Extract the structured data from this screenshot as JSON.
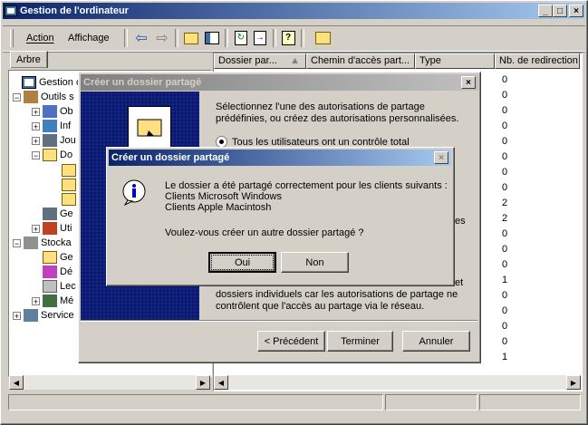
{
  "window": {
    "title": "Gestion de l'ordinateur",
    "buttons": [
      "_",
      "□",
      "×"
    ]
  },
  "menu": {
    "action": "Action",
    "view": "Affichage"
  },
  "tree": {
    "tab": "Arbre",
    "items": [
      {
        "label": "Gestion de"
      },
      {
        "label": "Outils s"
      },
      {
        "label": "Ob"
      },
      {
        "label": "Inf"
      },
      {
        "label": "Jou"
      },
      {
        "label": "Do"
      },
      {
        "label": ""
      },
      {
        "label": ""
      },
      {
        "label": ""
      },
      {
        "label": "Ge"
      },
      {
        "label": "Uti"
      },
      {
        "label": "Stocka"
      },
      {
        "label": "Ge"
      },
      {
        "label": "Dé"
      },
      {
        "label": "Lec"
      },
      {
        "label": "Mé"
      },
      {
        "label": "Service"
      }
    ]
  },
  "columns": {
    "headers": [
      "Dossier par...",
      "Chemin d'accès part...",
      "Type",
      "Nb. de redirection"
    ],
    "redirections": [
      "0",
      "0",
      "0",
      "0",
      "0",
      "0",
      "0",
      "0",
      "2",
      "2",
      "0",
      "0",
      "0",
      "1",
      "0",
      "0",
      "0",
      "0",
      "1"
    ]
  },
  "wizard": {
    "title": "Créer un dossier partagé",
    "intro": "Sélectionnez l'une des autorisations de partage prédéfinies, ou créez des autorisations personnalisées.",
    "option1": "Tous les utilisateurs ont un contrôle total",
    "side_fragment": "es",
    "side_fragment2": "et",
    "note": "dossiers individuels car les autorisations de partage ne contrôlent que l'accès au partage via le réseau.",
    "back": "< Précédent",
    "finish": "Terminer",
    "cancel": "Annuler"
  },
  "dialog": {
    "title": "Créer un dossier partagé",
    "line1": "Le dossier a été partagé correctement pour les clients suivants :",
    "line2": "Clients Microsoft Windows",
    "line3": "Clients Apple Macintosh",
    "question": "Voulez-vous créer un autre dossier partagé ?",
    "yes": "Oui",
    "no": "Non",
    "close": "×"
  }
}
